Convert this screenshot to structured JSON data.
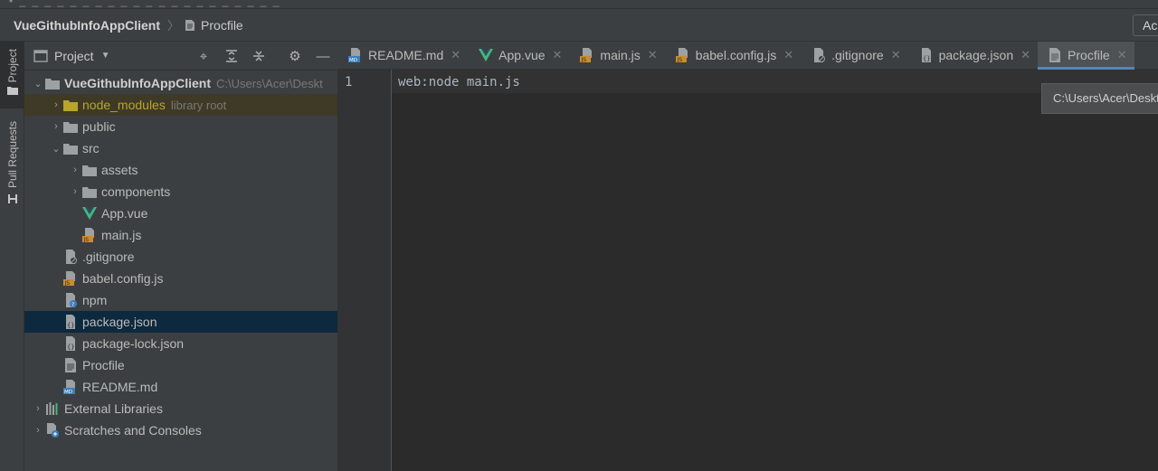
{
  "window": {
    "title_strip": "• _ _ _ _ _ _ _ _ _ _ _ _ _ _ _ _ _ _ _ _ _"
  },
  "navbar": {
    "project": "VueGithubInfoAppClient",
    "file": "Procfile",
    "right_button": "Ac"
  },
  "left_toolwindow": {
    "project_tab": "Project",
    "pull_requests_tab": "Pull Requests"
  },
  "project_panel": {
    "title": "Project",
    "tree": {
      "root": {
        "name": "VueGithubInfoAppClient",
        "path": "C:\\Users\\Acer\\Deskt"
      },
      "node_modules": {
        "name": "node_modules",
        "note": "library root"
      },
      "public": "public",
      "src": "src",
      "assets": "assets",
      "components": "components",
      "app_vue": "App.vue",
      "main_js": "main.js",
      "gitignore": ".gitignore",
      "babel": "babel.config.js",
      "npm": "npm",
      "package_json": "package.json",
      "package_lock": "package-lock.json",
      "procfile": "Procfile",
      "readme": "README.md",
      "external": "External Libraries",
      "scratches": "Scratches and Consoles"
    }
  },
  "editor": {
    "tabs": [
      "README.md",
      "App.vue",
      "main.js",
      "babel.config.js",
      ".gitignore",
      "package.json",
      "Procfile"
    ],
    "active_tab": "Procfile",
    "line_number": "1",
    "code_line": "web:node main.js",
    "tooltip": "C:\\Users\\Acer\\Deskt"
  },
  "colors": {
    "accent": "#4a88c7",
    "selection": "#0d293e",
    "vue_green": "#41b883",
    "js_badge": "#c98d2a"
  }
}
